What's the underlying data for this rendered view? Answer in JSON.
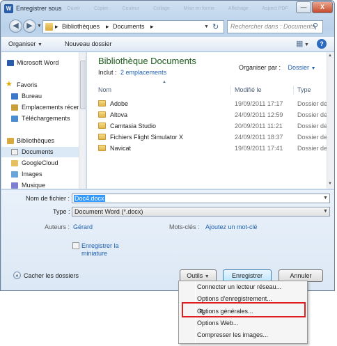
{
  "window": {
    "title": "Enregistrer sous",
    "background_tabs": [
      "Ouvrir",
      "Copier",
      "Couleur",
      "Collage",
      "Mise en forme",
      "Affichage",
      "Aspect PDF"
    ]
  },
  "title_buttons": {
    "min": "—",
    "max": "□",
    "close": "X"
  },
  "nav": {
    "breadcrumb": [
      "Bibliothèques",
      "Documents"
    ],
    "search_placeholder": "Rechercher dans : Documents"
  },
  "toolbar": {
    "organize": "Organiser",
    "new_folder": "Nouveau dossier"
  },
  "sidebar": {
    "items": [
      {
        "label": "Microsoft Word",
        "icon": "word-icon"
      },
      {
        "label": "Favoris",
        "icon": "star-icon"
      },
      {
        "label": "Bureau",
        "icon": "desktop-icon"
      },
      {
        "label": "Emplacements récents",
        "icon": "recent-places-icon"
      },
      {
        "label": "Téléchargements",
        "icon": "downloads-icon"
      },
      {
        "label": "Bibliothèques",
        "icon": "libraries-icon"
      },
      {
        "label": "Documents",
        "icon": "documents-icon",
        "selected": true
      },
      {
        "label": "GoogleCloud",
        "icon": "folder-icon"
      },
      {
        "label": "Images",
        "icon": "images-icon"
      },
      {
        "label": "Musique",
        "icon": "music-icon"
      }
    ]
  },
  "library": {
    "title": "Bibliothèque Documents",
    "includes_label": "Inclut :",
    "includes_link": "2 emplacements",
    "arrange_label": "Organiser par :",
    "arrange_value": "Dossier"
  },
  "columns": {
    "name": "Nom",
    "modified": "Modifié le",
    "type": "Type"
  },
  "files": [
    {
      "name": "Adobe",
      "modified": "19/09/2011 17:17",
      "type": "Dossier de fic"
    },
    {
      "name": "Altova",
      "modified": "24/09/2011 12:59",
      "type": "Dossier de fic"
    },
    {
      "name": "Camtasia Studio",
      "modified": "20/09/2011 11:21",
      "type": "Dossier de fic"
    },
    {
      "name": "Fichiers Flight Simulator X",
      "modified": "24/09/2011 18:37",
      "type": "Dossier de fic"
    },
    {
      "name": "Navicat",
      "modified": "19/09/2011 17:41",
      "type": "Dossier de fic"
    }
  ],
  "form": {
    "filename_label": "Nom de fichier :",
    "filename_value": "Doc4.docx",
    "type_label": "Type :",
    "type_value": "Document Word (*.docx)",
    "authors_label": "Auteurs :",
    "authors_value": "Gérard",
    "keywords_label": "Mots-clés :",
    "keywords_value": "Ajoutez un mot-clé",
    "thumbnail_line1": "Enregistrer la",
    "thumbnail_line2": "miniature",
    "hide_folders": "Cacher les dossiers"
  },
  "buttons": {
    "tools": "Outils",
    "save": "Enregistrer",
    "cancel": "Annuler"
  },
  "tools_menu": {
    "items": [
      "Connecter un lecteur réseau...",
      "Options d'enregistrement...",
      "Options générales...",
      "Options Web...",
      "Compresser les images..."
    ],
    "highlighted_index": 2
  },
  "colors": {
    "library_title": "#1e5d1e",
    "link": "#1f5fb0",
    "highlight": "#e02020"
  }
}
